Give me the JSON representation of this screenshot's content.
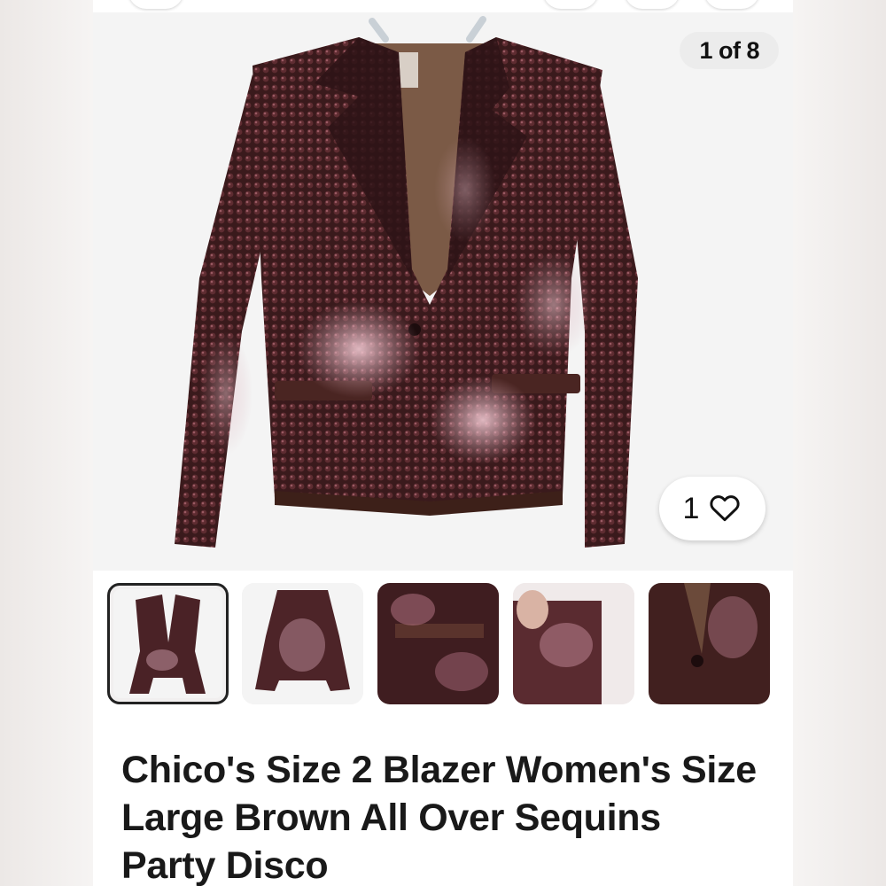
{
  "gallery": {
    "counter": "1 of 8",
    "current_index": 1,
    "total_images": 8
  },
  "likes": {
    "count": "1",
    "icon": "heart-outline-icon"
  },
  "thumbnails": [
    {
      "label": "blazer-front"
    },
    {
      "label": "blazer-back"
    },
    {
      "label": "pocket-closeup"
    },
    {
      "label": "cuff-closeup"
    },
    {
      "label": "button-closeup"
    }
  ],
  "listing": {
    "title": "Chico's Size 2 Blazer Women's Size Large Brown All Over Sequins Party Disco"
  },
  "colors": {
    "sequin_dark": "#3a1a1c",
    "sequin_mid": "#6a3236",
    "sequin_highlight": "#c99aa6",
    "lining": "#7b5a46"
  }
}
